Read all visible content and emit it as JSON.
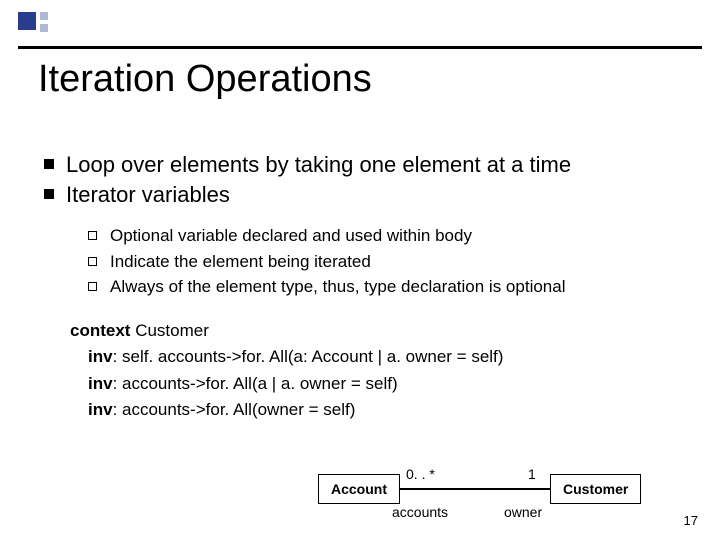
{
  "title": "Iteration Operations",
  "bullets_level1": [
    "Loop over elements by taking one element at a time",
    "Iterator variables"
  ],
  "bullets_level2": [
    "Optional variable declared and used within body",
    "Indicate the element being iterated",
    "Always of the element type, thus, type declaration is optional"
  ],
  "code": {
    "kw_context": "context",
    "context_name": " Customer",
    "kw_inv": "inv",
    "line1": ": self. accounts->for. All(a: Account | a. owner = self)",
    "line2": ": accounts->for. All(a | a. owner = self)",
    "line3": ": accounts->for. All(owner = self)"
  },
  "diagram": {
    "left_class": "Account",
    "right_class": "Customer",
    "mult_left": "0. . *",
    "mult_right": "1",
    "role_left": "accounts",
    "role_right": "owner"
  },
  "page_number": "17"
}
